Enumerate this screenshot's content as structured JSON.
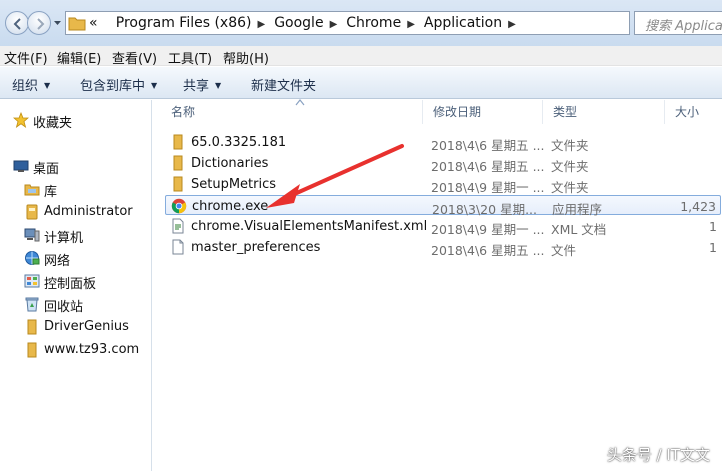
{
  "address": {
    "crumbs": [
      "«",
      "Program Files (x86)",
      "Google",
      "Chrome",
      "Application"
    ],
    "search_placeholder": "搜索 Application"
  },
  "menu": [
    "文件(F)",
    "编辑(E)",
    "查看(V)",
    "工具(T)",
    "帮助(H)"
  ],
  "toolbar": [
    "组织",
    "包含到库中",
    "共享",
    "新建文件夹"
  ],
  "nav": {
    "favorites": "收藏夹",
    "desktop": "桌面",
    "items": [
      "库",
      "Administrator",
      "计算机",
      "网络",
      "控制面板",
      "回收站",
      "DriverGenius",
      "www.tz93.com"
    ]
  },
  "columns": [
    "名称",
    "修改日期",
    "类型",
    "大小"
  ],
  "files": [
    {
      "name": "65.0.3325.181",
      "date": "2018\\4\\6 星期五 ...",
      "type": "文件夹",
      "size": "",
      "icon": "folder-icon"
    },
    {
      "name": "Dictionaries",
      "date": "2018\\4\\6 星期五 ...",
      "type": "文件夹",
      "size": "",
      "icon": "folder-icon"
    },
    {
      "name": "SetupMetrics",
      "date": "2018\\4\\9 星期一 ...",
      "type": "文件夹",
      "size": "",
      "icon": "folder-icon"
    },
    {
      "name": "chrome.exe",
      "date": "2018\\3\\20 星期...",
      "type": "应用程序",
      "size": "1,423",
      "icon": "chrome-icon"
    },
    {
      "name": "chrome.VisualElementsManifest.xml",
      "date": "2018\\4\\9 星期一 ...",
      "type": "XML 文档",
      "size": "1",
      "icon": "xml-file-icon"
    },
    {
      "name": "master_preferences",
      "date": "2018\\4\\6 星期五 ...",
      "type": "文件",
      "size": "1",
      "icon": "file-icon"
    }
  ],
  "watermark": "头条号 / IT文文",
  "colors": {
    "selection_border": "#84acdd",
    "annotation_arrow": "#e8312e",
    "folder": "#e8b84a"
  }
}
